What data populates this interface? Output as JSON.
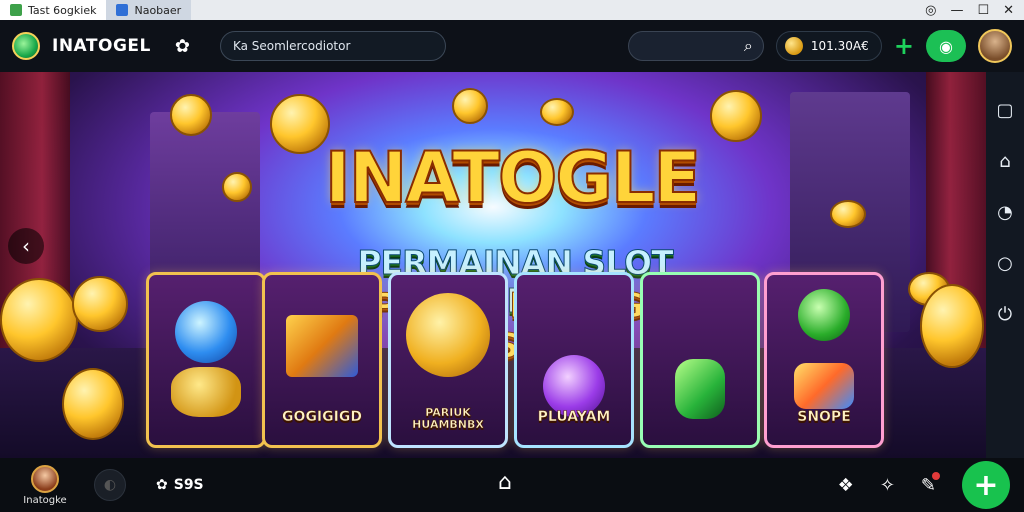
{
  "titlebar": {
    "tab1_title": "Tast 6ogkiek",
    "tab2_title": "Naobaer",
    "icon_colors": [
      "#3ea14a",
      "#2f6fd6"
    ]
  },
  "header": {
    "brand": "INATOGEL",
    "address_text": "Ka Seomlercodiotor",
    "balance": "101.30A€",
    "icons": {
      "settings": "gear-icon",
      "search": "search-icon",
      "add": "plus-icon",
      "chat": "chat-icon"
    }
  },
  "banner": {
    "title": "INATOGLE",
    "subtitle_line1": "PERMAINAN SLOT TERBAIK",
    "subtitle_line2": "PUIR MENANG BESAR",
    "cards": [
      {
        "label": "",
        "icon": "blue-gem-icon"
      },
      {
        "label": "GOGIGIGD",
        "icon": "golden-cards-icon"
      },
      {
        "label": "PARIUK\nHUAMBNBX",
        "icon": "gold-medallion-icon"
      },
      {
        "label": "PLUAYAM",
        "icon": "purple-gem-icon"
      },
      {
        "label": "",
        "icon": "green-phone-icon"
      },
      {
        "label": "SNOPE",
        "icon": "treasure-gem-icon"
      }
    ]
  },
  "siderail": {
    "icons": [
      "square-icon",
      "home-icon",
      "water-drop-icon",
      "search-icon",
      "power-icon"
    ]
  },
  "bottombar": {
    "username": "Inatogke",
    "settings_label": "S9S",
    "accent": "#18c24e"
  }
}
